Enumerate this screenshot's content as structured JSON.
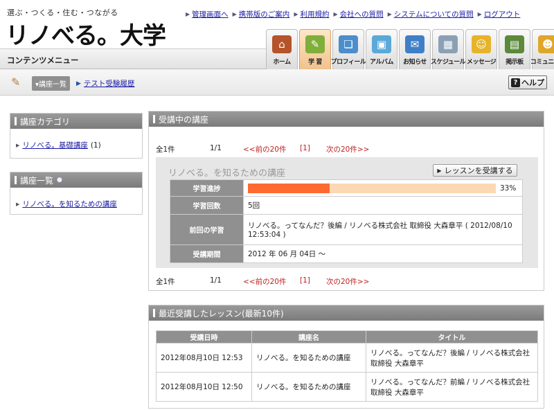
{
  "header": {
    "tagline": "選ぶ・つくる・住む・つながる",
    "logo": "リノべる。大学",
    "menu_label": "コンテンツメニュー",
    "top_links": [
      {
        "label": "管理画面へ"
      },
      {
        "label": "携帯版のご案内"
      },
      {
        "label": "利用規約"
      },
      {
        "label": "会社への質問"
      },
      {
        "label": "システムについての質問"
      },
      {
        "label": "ログアウト"
      }
    ]
  },
  "nav": [
    {
      "label": "ホーム",
      "icon": "house-icon",
      "color": "#b5532a"
    },
    {
      "label": "学 習",
      "icon": "pencil-notebook-icon",
      "color": "#7fae3a",
      "active": true
    },
    {
      "label": "プロフィール",
      "icon": "profile-book-icon",
      "color": "#4b8ecb"
    },
    {
      "label": "アルバム",
      "icon": "album-icon",
      "color": "#5aa9d8"
    },
    {
      "label": "お知らせ",
      "icon": "mail-icon",
      "color": "#3f7fc7"
    },
    {
      "label": "スケジュール",
      "icon": "calendar-icon",
      "color": "#8aa0b5"
    },
    {
      "label": "メッセージ",
      "icon": "people-message-icon",
      "color": "#e6b42a"
    },
    {
      "label": "掲示板",
      "icon": "board-icon",
      "color": "#5b8a3a"
    },
    {
      "label": "コミュニティ",
      "icon": "community-icon",
      "color": "#e0a62a"
    }
  ],
  "subbar": {
    "course_list_btn": "▾講座一覧",
    "crumb_link": "テスト受験履歴",
    "help": "ヘルプ",
    "help_q": "?"
  },
  "sidebar": {
    "category": {
      "title": "講座カテゴリ",
      "link": "リノべる。基礎講座",
      "count": "(1)"
    },
    "course_list": {
      "title": "講座一覧",
      "link": "リノべる。を知るための講座"
    }
  },
  "current": {
    "title": "受講中の講座",
    "pager": {
      "count": "全1件",
      "page": "1/1",
      "prev": "<<前の20件",
      "current": "[1]",
      "next": "次の20件>>"
    },
    "course": {
      "title": "リノべる。を知るための講座",
      "attend_btn": "レッスンを受講する",
      "rows": {
        "progress_label": "学習進捗",
        "progress_pct": "33%",
        "progress_value": 0.33,
        "count_label": "学習回数",
        "count_value": "5回",
        "last_label": "前回の学習",
        "last_value": "リノべる。ってなんだ？後編 / リノベる株式会社 取締役 大森章平 ( 2012/08/10 12:53:04 )",
        "period_label": "受講期間",
        "period_value": "2012 年 06 月 04日 〜"
      }
    }
  },
  "recent": {
    "title": "最近受講したレッスン(最新10件)",
    "columns": [
      "受講日時",
      "講座名",
      "タイトル"
    ],
    "rows": [
      {
        "date": "2012年08月10日 12:53",
        "course": "リノべる。を知るための講座",
        "title": "リノべる。ってなんだ？後編 / リノべる株式会社 取締役 大森章平"
      },
      {
        "date": "2012年08月10日 12:50",
        "course": "リノべる。を知るための講座",
        "title": "リノべる。ってなんだ？前編 / リノべる株式会社 取締役 大森章平"
      }
    ]
  }
}
